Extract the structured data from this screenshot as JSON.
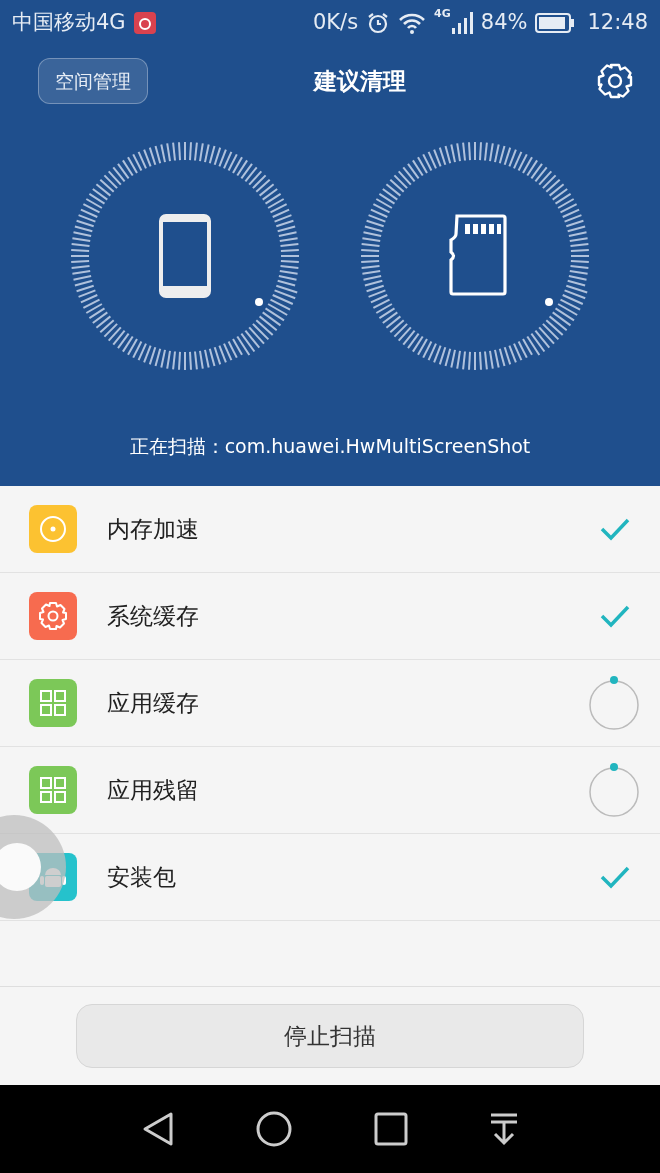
{
  "status_bar": {
    "carrier": "中国移动4G",
    "speed": "0K/s",
    "network": "4G",
    "battery": "84%",
    "time": "12:48"
  },
  "header": {
    "left_button": "空间管理",
    "title": "建议清理"
  },
  "scanning_text": "正在扫描：com.huawei.HwMultiScreenShot",
  "items": [
    {
      "label": "内存加速",
      "kind": "memory",
      "color": "#fcc231",
      "done": true
    },
    {
      "label": "系统缓存",
      "kind": "system",
      "color": "#f76b4f",
      "done": true
    },
    {
      "label": "应用缓存",
      "kind": "apps",
      "color": "#7cc858",
      "done": false
    },
    {
      "label": "应用残留",
      "kind": "apps",
      "color": "#7cc858",
      "done": false
    },
    {
      "label": "安装包",
      "kind": "package",
      "color": "#25c2cc",
      "done": true
    }
  ],
  "stop_button": "停止扫描"
}
